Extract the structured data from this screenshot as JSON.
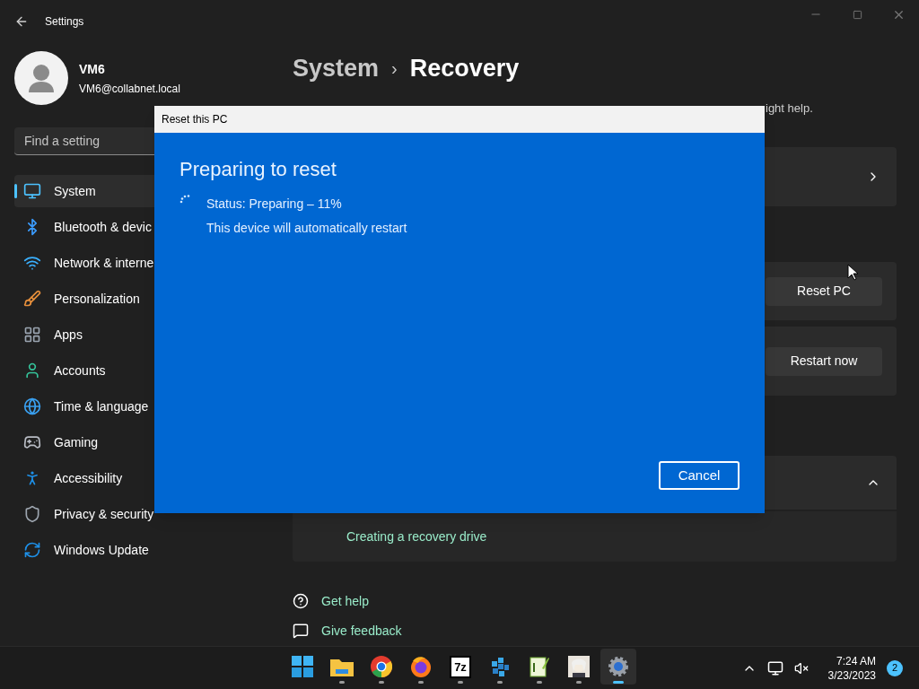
{
  "window": {
    "title": "Settings"
  },
  "account": {
    "name": "VM6",
    "email": "VM6@collabnet.local"
  },
  "search": {
    "placeholder": "Find a setting"
  },
  "sidebar": {
    "items": [
      {
        "label": "System",
        "selected": true
      },
      {
        "label": "Bluetooth & devic",
        "selected": false
      },
      {
        "label": "Network & interne",
        "selected": false
      },
      {
        "label": "Personalization",
        "selected": false
      },
      {
        "label": "Apps",
        "selected": false
      },
      {
        "label": "Accounts",
        "selected": false
      },
      {
        "label": "Time & language",
        "selected": false
      },
      {
        "label": "Gaming",
        "selected": false
      },
      {
        "label": "Accessibility",
        "selected": false
      },
      {
        "label": "Privacy & security",
        "selected": false
      },
      {
        "label": "Windows Update",
        "selected": false
      }
    ]
  },
  "breadcrumb": {
    "parent": "System",
    "separator": "›",
    "current": "Recovery"
  },
  "description": "ight help.",
  "cards": [
    {
      "kind": "nav"
    },
    {
      "kind": "action",
      "button": "Reset PC"
    },
    {
      "kind": "action",
      "button": "Restart now"
    },
    {
      "kind": "expander",
      "expanded": true,
      "links": [
        "Creating a recovery drive"
      ]
    }
  ],
  "help_links": [
    "Get help",
    "Give feedback"
  ],
  "dialog": {
    "title": "Reset this PC",
    "heading": "Preparing to reset",
    "status": "Status: Preparing – 11%",
    "note": "This device will automatically restart",
    "cancel": "Cancel"
  },
  "taskbar": {
    "apps": [
      {
        "kind": "start",
        "running": false,
        "selected": false
      },
      {
        "kind": "folder",
        "running": true,
        "selected": false
      },
      {
        "kind": "chrome",
        "running": true,
        "selected": false
      },
      {
        "kind": "firefox",
        "running": true,
        "selected": false
      },
      {
        "kind": "archiver",
        "label": "7z",
        "running": true,
        "selected": false
      },
      {
        "kind": "cube",
        "running": true,
        "selected": false
      },
      {
        "kind": "notepad",
        "running": true,
        "selected": false
      },
      {
        "kind": "picture",
        "running": true,
        "selected": false
      },
      {
        "kind": "gear",
        "running": true,
        "selected": true
      }
    ],
    "time": "7:24 AM",
    "date": "3/23/2023",
    "notifications": "2"
  }
}
